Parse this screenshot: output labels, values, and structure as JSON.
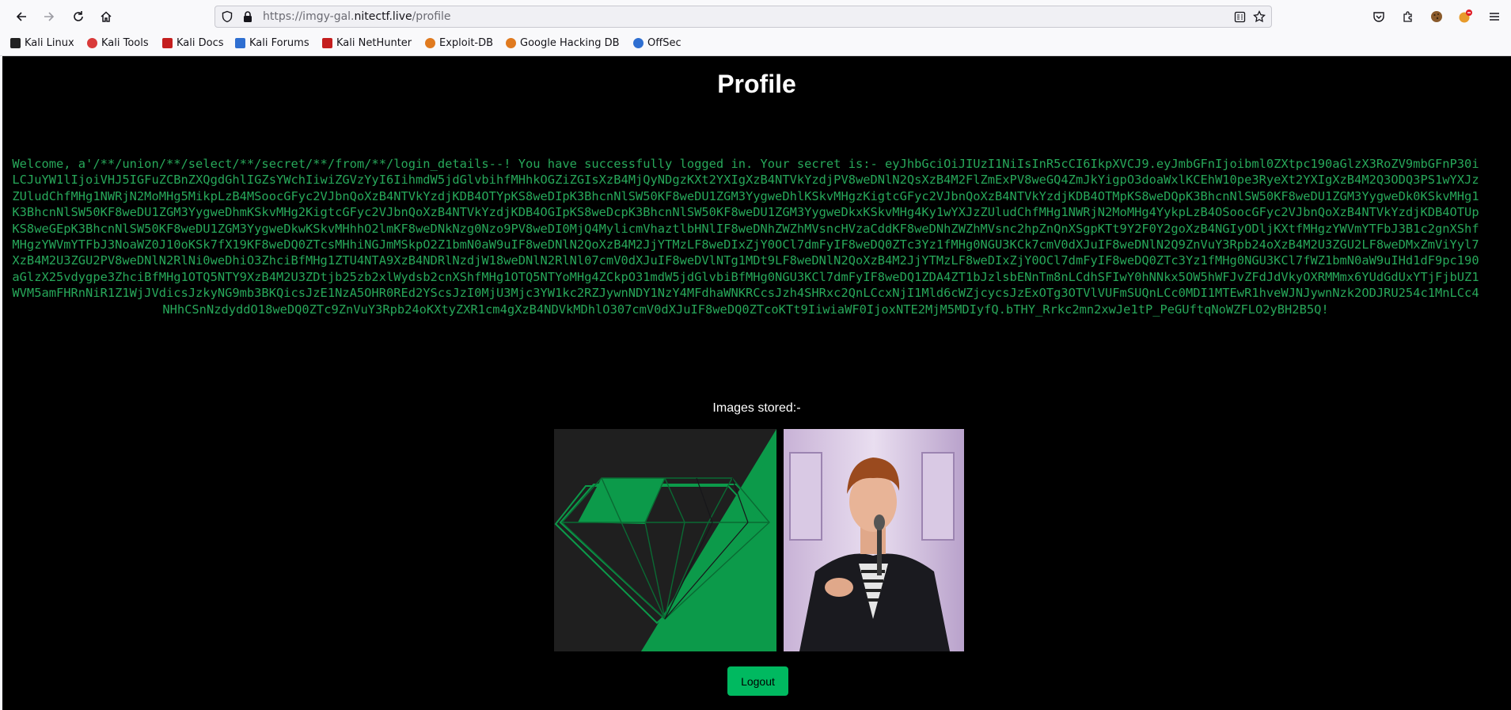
{
  "browser": {
    "url_prefix": "https://imgy-gal.",
    "url_host": "nitectf.live",
    "url_path": "/profile",
    "bookmarks": [
      {
        "label": "Kali Linux",
        "color": "#222222"
      },
      {
        "label": "Kali Tools",
        "color": "#d93a3a"
      },
      {
        "label": "Kali Docs",
        "color": "#c41e1e"
      },
      {
        "label": "Kali Forums",
        "color": "#2f6fd1"
      },
      {
        "label": "Kali NetHunter",
        "color": "#c41e1e"
      },
      {
        "label": "Exploit-DB",
        "color": "#e07a1f"
      },
      {
        "label": "Google Hacking DB",
        "color": "#e07a1f"
      },
      {
        "label": "OffSec",
        "color": "#2f6fd1"
      }
    ]
  },
  "page": {
    "title": "Profile",
    "secret_message": "Welcome, a'/**/union/**/select/**/secret/**/from/**/login_details--! You have successfully logged in. Your secret is:- eyJhbGciOiJIUzI1NiIsInR5cCI6IkpXVCJ9.eyJmbGFnIjoibml0ZXtpc190aGlzX3RoZV9mbGFnP30iLCJuYW1lIjoiVHJ5IGFuZCBnZXQgdGhlIGZsYWchIiwiZGVzYyI6IihmdW5jdGlvbihfMHhkOGZiZGIsXzB4MjQyNDgzKXt2YXIgXzB4NTVkYzdjPV8weDNlN2QsXzB4M2FlZmExPV8weGQ4ZmJkYigpO3doaWxlKCEhW10pe3RyeXt2YXIgXzB4M2Q3ODQ3PS1wYXJzZUludChfMHg1NWRjN2MoMHg5MikpLzB4MSoocGFyc2VJbnQoXzB4NTVkYzdjKDB4OTYpKS8weDIpK3BhcnNlSW50KF8weDU1ZGM3YygweDhlKSkvMHgzKigtcGFyc2VJbnQoXzB4NTVkYzdjKDB4OTMpKS8weDQpK3BhcnNlSW50KF8weDU1ZGM3YygweDk0KSkvMHg1K3BhcnNlSW50KF8weDU1ZGM3YygweDhmKSkvMHg2KigtcGFyc2VJbnQoXzB4NTVkYzdjKDB4OGIpKS8weDcpK3BhcnNlSW50KF8weDU1ZGM3YygweDkxKSkvMHg4Ky1wYXJzZUludChfMHg1NWRjN2MoMHg4YykpLzB4OSoocGFyc2VJbnQoXzB4NTVkYzdjKDB4OTUpKS8weGEpK3BhcnNlSW50KF8weDU1ZGM3YygweDkwKSkvMHhhO2lmKF8weDNkNzg0Nzo9PV8weDI0MjQ4MylicmVhaztlbHNlIF8weDNhZWZhMVsncHVzaCddKF8weDNhZWZhMVsnc2hpZnQnXSgpKTt9Y2F0Y2goXzB4NGIyODljKXtfMHgzYWVmYTFbJ3B1c2gnXShfMHgzYWVmYTFbJ3NoaWZ0J10oKSk7fX19KF8weDQ0ZTcsMHhiNGJmMSkpO2Z1bmN0aW9uIF8weDNlN2QoXzB4M2JjYTMzLF8weDIxZjY0OCl7dmFyIF8weDQ0ZTc3Yz1fMHg0NGU3KCk7cmV0dXJuIF8weDNlN2Q9ZnVuY3Rpb24oXzB4M2U3ZGU2LF8weDMxZmViYyl7XzB4M2U3ZGU2PV8weDNlN2RlNi0weDhiO3ZhciBfMHg1ZTU4NTA9XzB4NDRlNzdjW18weDNlN2RlNl07cmV0dXJuIF8weDVlNTg1MDt9LF8weDNlN2QoXzB4M2JjYTMzLF8weDIxZjY0OCl7dmFyIF8weDQ0ZTc3Yz1fMHg0NGU3KCl7fWZ1bmN0aW9uIHd1dF9pc190aGlzX25vdygpe3ZhciBfMHg1OTQ5NTY9XzB4M2U3ZDtjb25zb2xlWydsb2cnXShfMHg1OTQ5NTYoMHg4ZCkpO31mdW5jdGlvbiBfMHg0NGU3KCl7dmFyIF8weDQ1ZDA4ZT1bJzlsbENnTm8nLCdhSFIwY0hNNkx5OW5hWFJvZFdJdVkyOXRMMmx6YUdGdUxYTjFjbUZ1WVM5amFHRnNiR1Z1WjJVdicsJzkyNG9mb3BKQicsJzE1NzA5OHR0REd2YScsJzI0MjU3Mjc3YW1kc2RZJywnNDY1NzY4MFdhaWNKRCcsJzh4SHRxc2QnLCcxNjI1Mld6cWZjcycsJzExOTg3OTVlVUFmSUQnLCc0MDI1MTEwR1hveWJNJywnNzk2ODJRU254c1MnLCc4NHhCSnNzdyddO18weDQ0ZTc9ZnVuY3Rpb24oKXtyZXR1cm4gXzB4NDVkMDhlO307cmV0dXJuIF8weDQ0ZTcoKTt9IiwiaWF0IjoxNTE2MjM5MDIyfQ.bTHY_Rrkc2mn2xwJe1tP_PeGUftqNoWZFLO2yBH2B5Q!",
    "images_label": "Images stored:-",
    "logout_label": "Logout"
  }
}
